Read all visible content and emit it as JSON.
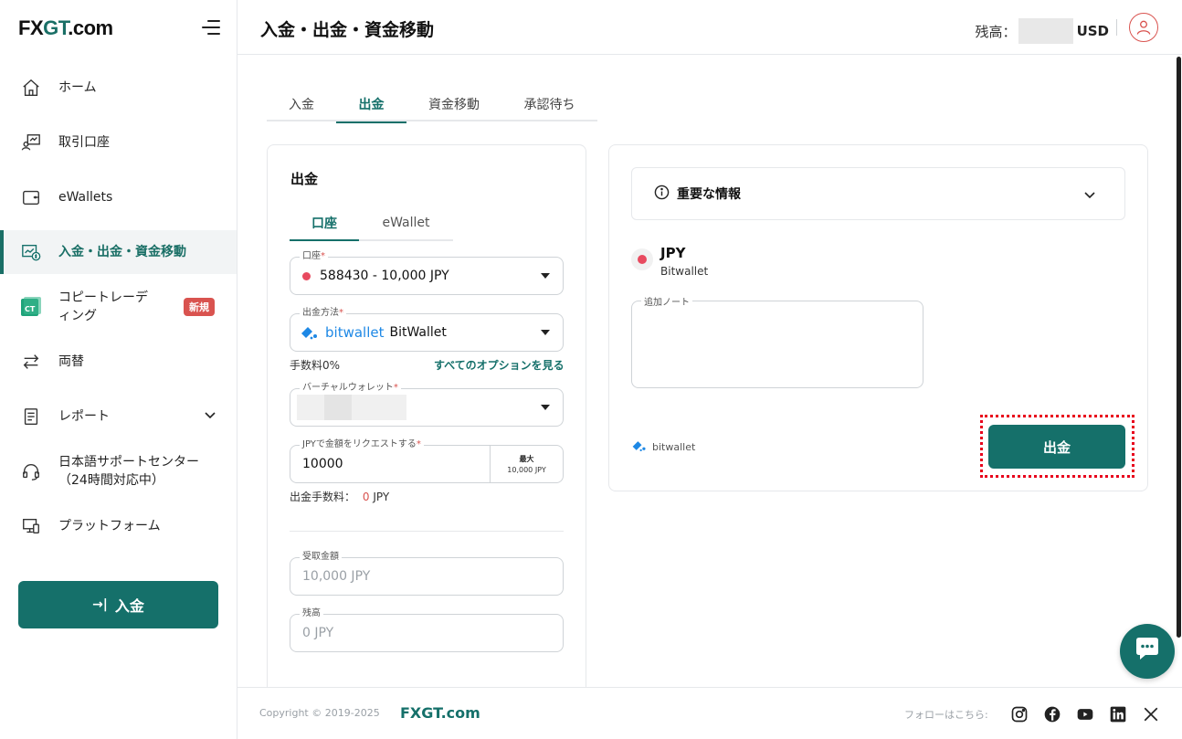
{
  "brand": {
    "logo_fx": "FX",
    "logo_g": "GT",
    "logo_rest": ".com"
  },
  "sidebar": {
    "items": [
      {
        "label": "ホーム",
        "icon": "home-icon"
      },
      {
        "label": "取引口座",
        "icon": "trading-account-icon"
      },
      {
        "label": "eWallets",
        "icon": "wallet-icon"
      },
      {
        "label": "入金・出金・資金移動",
        "icon": "funds-transfer-icon"
      },
      {
        "label": "コピートレーディング",
        "icon": "copy-trading-icon",
        "badge": "新規"
      },
      {
        "label": "両替",
        "icon": "exchange-icon"
      },
      {
        "label": "レポート",
        "icon": "report-icon"
      },
      {
        "label": "日本語サポートセンター（24時間対応中）",
        "icon": "headset-icon"
      },
      {
        "label": "プラットフォーム",
        "icon": "platform-icon"
      }
    ],
    "deposit_button": "入金"
  },
  "header": {
    "title": "入金・出金・資金移動",
    "balance_label": "残高：",
    "balance_currency": "USD"
  },
  "tabs": [
    "入金",
    "出金",
    "資金移動",
    "承認待ち"
  ],
  "withdraw": {
    "title": "出金",
    "subtabs": [
      "口座",
      "eWallet"
    ],
    "account_label": "口座",
    "account_value": "588430 - 10,000 JPY",
    "method_label": "出金方法",
    "method_logo": "bitwallet",
    "method_value": "BitWallet",
    "fee_text": "手数料0%",
    "all_options_link": "すべてのオプションを見る",
    "virtual_wallet_label": "バーチャルウォレット",
    "amount_label": "JPYで金額をリクエストする",
    "amount_value": "10000",
    "max_label": "最大",
    "max_value": "10,000 JPY",
    "withdraw_fee_label": "出金手数料：",
    "withdraw_fee_value": "0",
    "withdraw_fee_currency": "JPY",
    "receive_label": "受取金額",
    "receive_value": "10,000 JPY",
    "balance_label": "残高",
    "balance_value": "0 JPY"
  },
  "info": {
    "important_title": "重要な情報",
    "currency_code": "JPY",
    "currency_method": "Bitwallet",
    "note_label": "追加ノート",
    "bitwallet_logo": "bitwallet",
    "withdraw_button": "出金"
  },
  "footer": {
    "copyright": "Copyright © 2019-2025",
    "brand": "FXGT.com",
    "follow_label": "フォローはこちら:",
    "social": [
      "instagram-icon",
      "facebook-icon",
      "youtube-icon",
      "linkedin-icon",
      "x-icon"
    ]
  },
  "colors": {
    "primary": "#15706a",
    "danger": "#d9534f",
    "highlight": "#e8001c"
  }
}
